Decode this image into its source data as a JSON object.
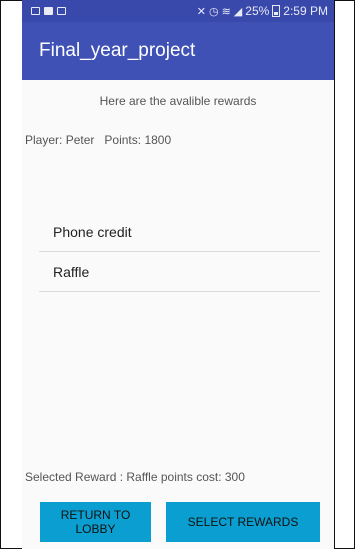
{
  "status_bar": {
    "signal_text": "25%",
    "time": "2:59 PM",
    "icons": [
      "gallery-icon",
      "message-icon",
      "photo-icon",
      "mute-icon",
      "alarm-icon",
      "wifi-icon",
      "signal-icon",
      "battery-icon"
    ]
  },
  "app_bar": {
    "title": "Final_year_project"
  },
  "main": {
    "heading": "Here are the avalible rewards",
    "player_label": "Player:",
    "player_name": "Peter",
    "points_label": "Points:",
    "points_value": "1800",
    "rewards": [
      {
        "label": "Phone credit"
      },
      {
        "label": "Raffle"
      }
    ],
    "selected_text": "Selected Reward : Raffle points cost: 300"
  },
  "buttons": {
    "return_lobby": "RETURN TO LOBBY",
    "select_rewards": "SELECT REWARDS"
  },
  "colors": {
    "app_bar": "#3f51b5",
    "status_bar": "#3949ab",
    "button": "#0a9fd0"
  }
}
